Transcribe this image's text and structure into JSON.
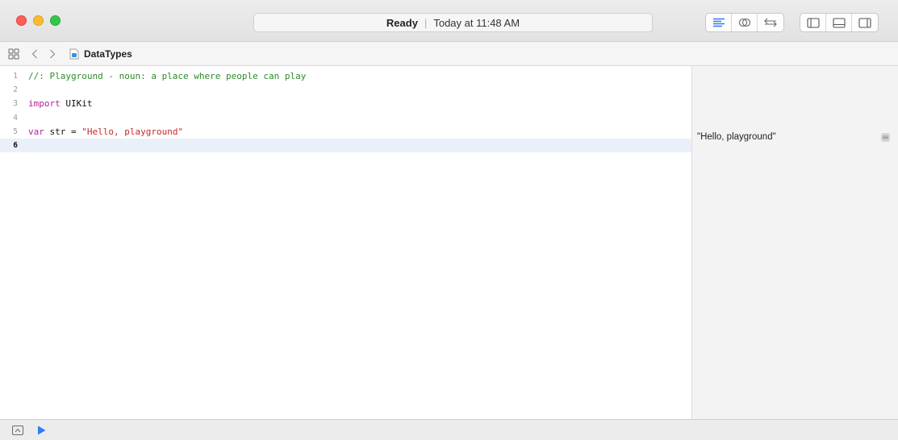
{
  "window": {
    "activity": {
      "status": "Ready",
      "separator": "|",
      "time": "Today at 11:48 AM"
    },
    "toolbar": {
      "editor_modes": [
        "standard-editor-icon",
        "assistant-editor-icon",
        "version-editor-icon"
      ],
      "panel_toggles": [
        "navigator-panel-icon",
        "debug-panel-icon",
        "utilities-panel-icon"
      ]
    },
    "accent": "#3478f6"
  },
  "jumpbar": {
    "file_name": "DataTypes"
  },
  "editor": {
    "lines": [
      {
        "number": "1",
        "tokens": [
          {
            "type": "comment",
            "text": "//: Playground - noun: a place where people can play"
          }
        ]
      },
      {
        "number": "2",
        "tokens": []
      },
      {
        "number": "3",
        "tokens": [
          {
            "type": "kw",
            "text": "import"
          },
          {
            "type": "plain",
            "text": " UIKit"
          }
        ]
      },
      {
        "number": "4",
        "tokens": []
      },
      {
        "number": "5",
        "tokens": [
          {
            "type": "kw",
            "text": "var"
          },
          {
            "type": "plain",
            "text": " str = "
          },
          {
            "type": "str",
            "text": "\"Hello, playground\""
          }
        ]
      },
      {
        "number": "6",
        "tokens": [],
        "current": true
      }
    ]
  },
  "results": {
    "value": "\"Hello, playground\""
  }
}
